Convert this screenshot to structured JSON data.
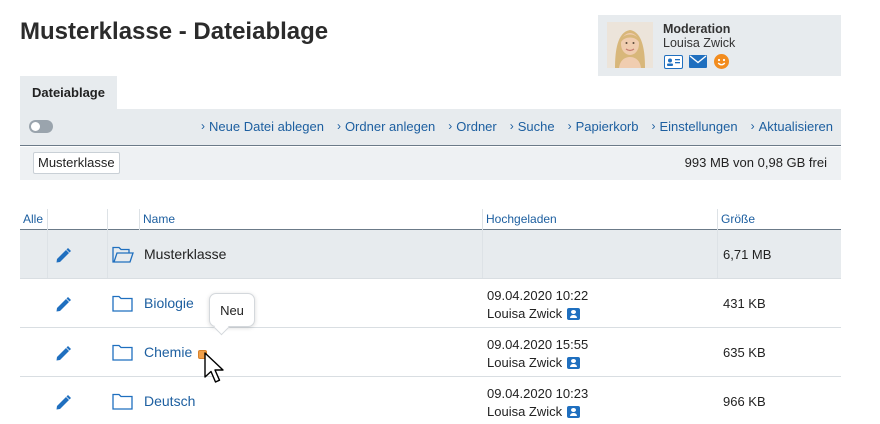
{
  "page": {
    "title": "Musterklasse - Dateiablage"
  },
  "moderation": {
    "title": "Moderation",
    "name": "Louisa Zwick",
    "icons": [
      "contact-card-icon",
      "mail-icon",
      "smiley-icon"
    ]
  },
  "tabs": [
    {
      "label": "Dateiablage",
      "active": true
    }
  ],
  "toolbar": {
    "toggle_on": false,
    "actions": [
      "Neue Datei ablegen",
      "Ordner anlegen",
      "Ordner",
      "Suche",
      "Papierkorb",
      "Einstellungen",
      "Aktualisieren"
    ]
  },
  "infobar": {
    "breadcrumb": "Musterklasse",
    "quota": "993 MB von 0,98 GB frei"
  },
  "table": {
    "headers": {
      "select": "Alle",
      "name": "Name",
      "uploaded": "Hochgeladen",
      "size": "Größe"
    },
    "rows": [
      {
        "name": "Musterklasse",
        "date": "",
        "user": "",
        "size": "6,71 MB",
        "is_new": false
      },
      {
        "name": "Biologie",
        "date": "09.04.2020 10:22",
        "user": "Louisa Zwick",
        "size": "431 KB",
        "is_new": false
      },
      {
        "name": "Chemie",
        "date": "09.04.2020 15:55",
        "user": "Louisa Zwick",
        "size": "635 KB",
        "is_new": true
      },
      {
        "name": "Deutsch",
        "date": "09.04.2020 10:23",
        "user": "Louisa Zwick",
        "size": "966 KB",
        "is_new": false
      }
    ]
  },
  "tooltip": {
    "text": "Neu"
  },
  "colors": {
    "accent": "#1d5fa0",
    "panel": "#e7ebee",
    "badge": "#f0a04b",
    "smiley": "#f28c1e"
  }
}
